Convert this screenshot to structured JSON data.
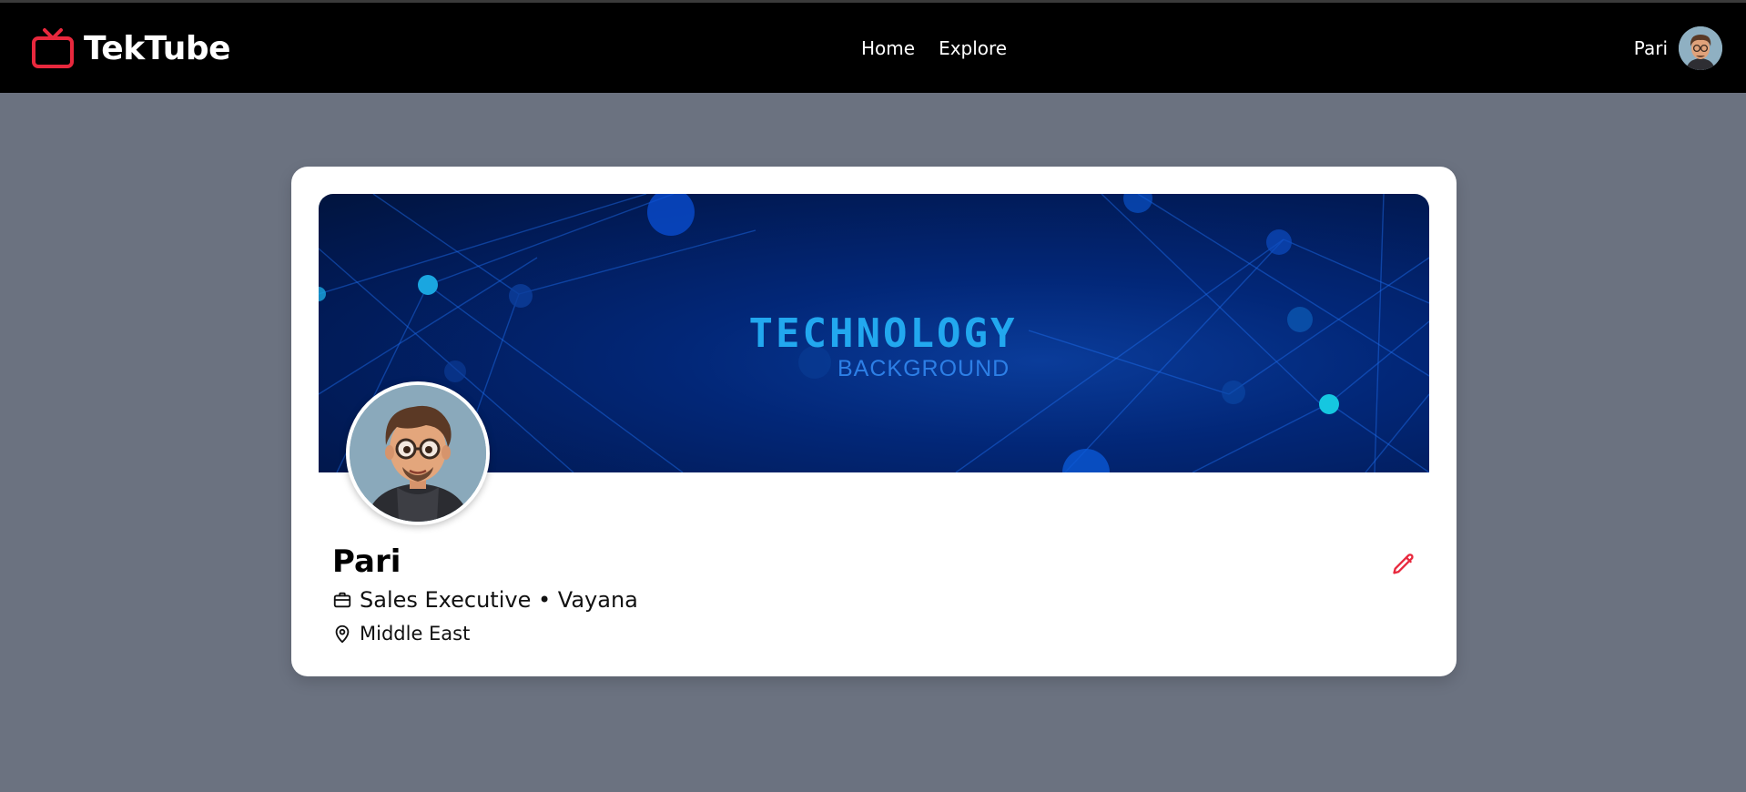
{
  "app": {
    "brand_name": "TekTube",
    "brand_color": "#e8283d"
  },
  "nav": {
    "links": [
      {
        "label": "Home"
      },
      {
        "label": "Explore"
      }
    ],
    "user_name": "Pari"
  },
  "banner": {
    "title": "TECHNOLOGY",
    "subtitle": "BACKGROUND"
  },
  "profile": {
    "name": "Pari",
    "role_line": "Sales Executive • Vayana",
    "location": "Middle East",
    "edit_icon_color": "#e8283d"
  },
  "icons": {
    "brand": "tv-icon",
    "role": "briefcase-icon",
    "location": "map-pin-icon",
    "edit": "pencil-icon"
  }
}
